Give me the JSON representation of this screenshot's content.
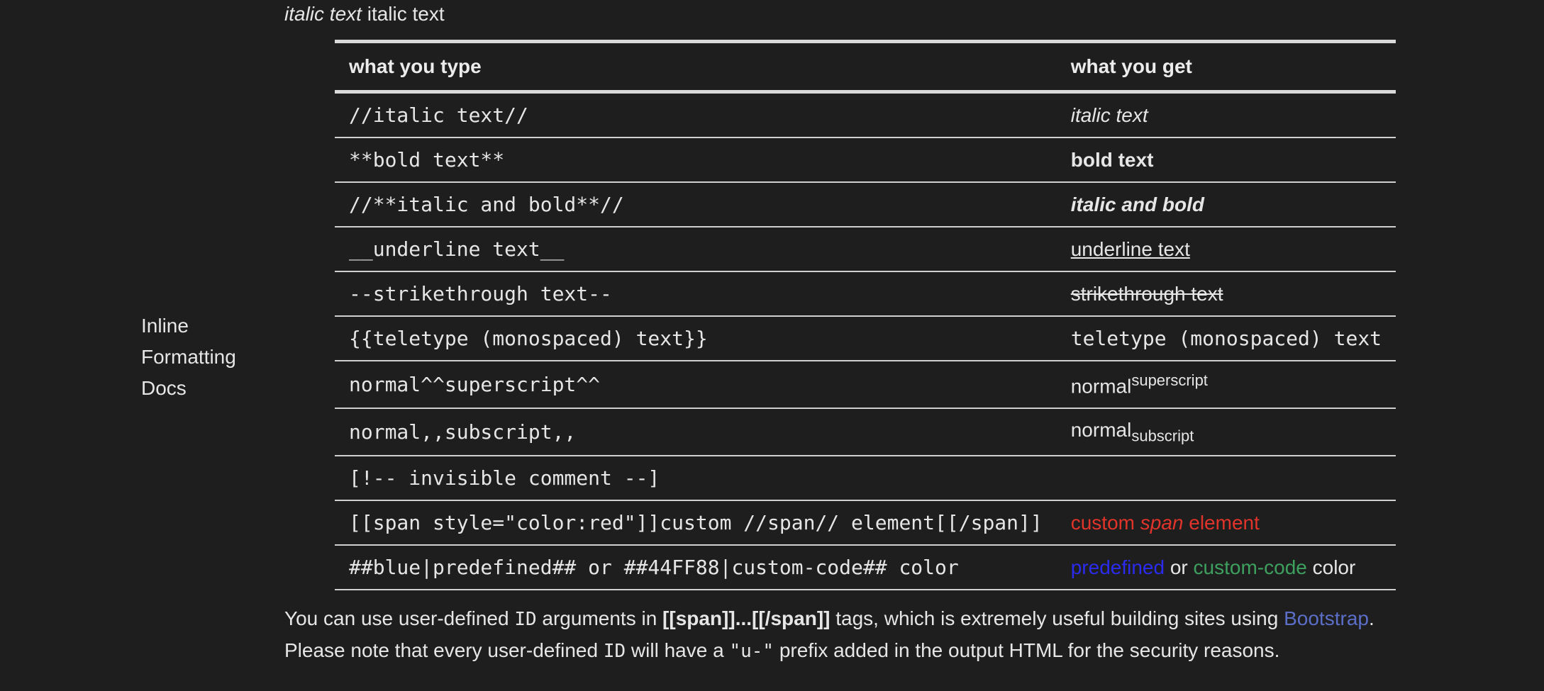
{
  "top_line": {
    "italic": "italic text",
    "plain": "italic text"
  },
  "side_label": [
    "Inline",
    "Formatting",
    "Docs"
  ],
  "table": {
    "headers": [
      "what you type",
      "what you get"
    ],
    "rows": [
      {
        "type": "//italic text//",
        "get": "italic text"
      },
      {
        "type": "**bold text**",
        "get": "bold text"
      },
      {
        "type": "//**italic and bold**//",
        "get": "italic and bold"
      },
      {
        "type": "__underline text__",
        "get": "underline text"
      },
      {
        "type": "--strikethrough text--",
        "get": "strikethrough text"
      },
      {
        "type": "{{teletype (monospaced) text}}",
        "get": "teletype (monospaced) text"
      },
      {
        "type": "normal^^superscript^^",
        "get_normal": "normal",
        "get_sup": "superscript"
      },
      {
        "type": "normal,,subscript,,",
        "get_normal": "normal",
        "get_sub": "subscript"
      },
      {
        "type": "[!-- invisible comment --]",
        "get": ""
      },
      {
        "type": "[[span style=\"color:red\"]]custom //span// element[[/span]]",
        "get_a": "custom ",
        "get_b": "span",
        "get_c": " element"
      },
      {
        "type": "##blue|predefined## or ##44FF88|custom-code## color",
        "get_a": "predefined",
        "get_b": " or ",
        "get_c": "custom-code",
        "get_d": " color"
      }
    ]
  },
  "paragraph": {
    "t1": "You can use user-defined ",
    "code1": "ID",
    "t2": " arguments in ",
    "bold1": "[[span]]...[[/span]]",
    "t3": " tags, which is extremely useful building sites using ",
    "link": "Bootstrap",
    "t4": ". Please note that every user-defined ",
    "code2": "ID",
    "t5": " will have a ",
    "code3": "\"u-\"",
    "t6": " prefix added in the output HTML for the security reasons."
  },
  "colors": {
    "background": "#1e1e1e",
    "text": "#e6e6e6",
    "red": "#e0342a",
    "blue": "#2b2bf0",
    "green": "#3ea05f",
    "link": "#5b6ec8"
  }
}
